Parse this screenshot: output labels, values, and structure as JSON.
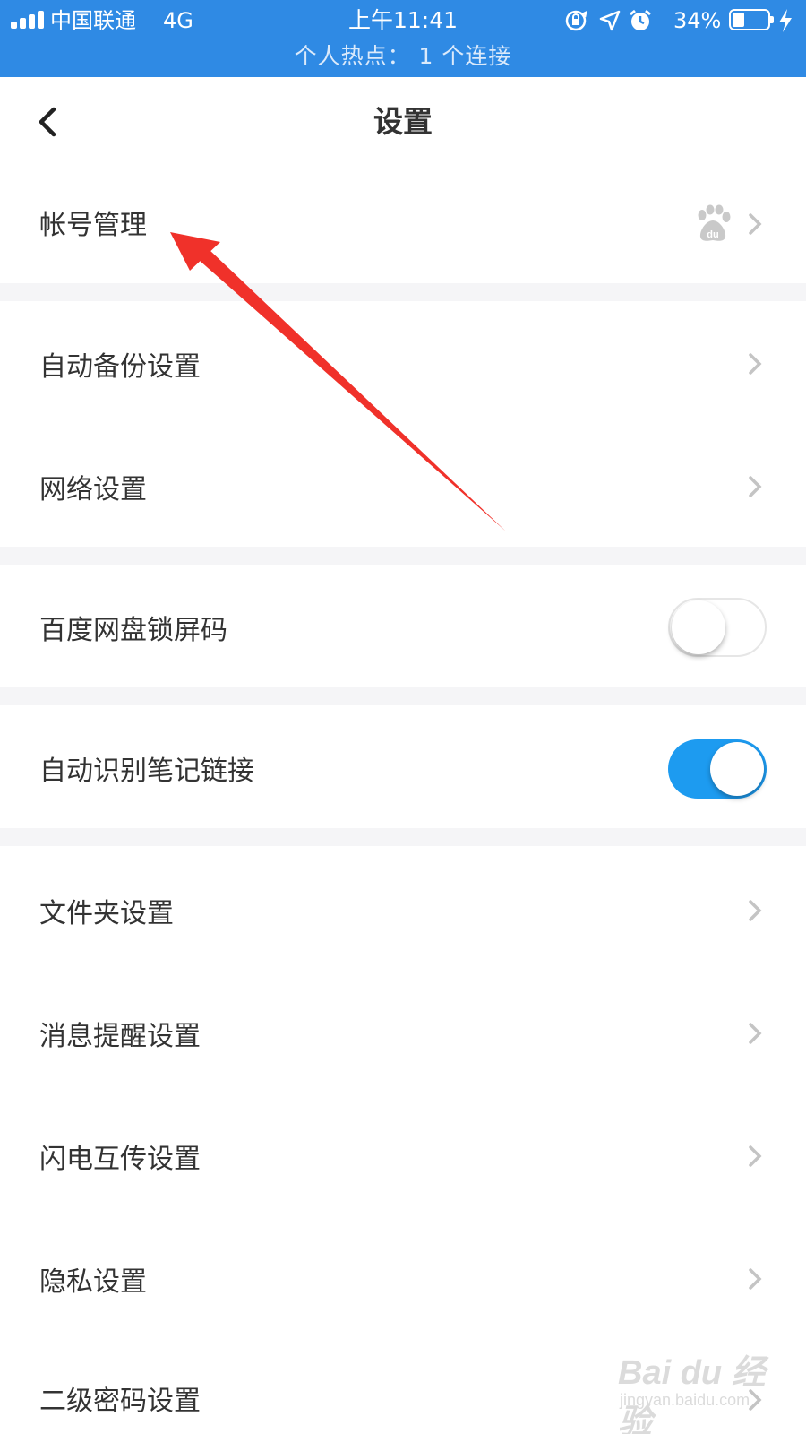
{
  "status_bar": {
    "carrier": "中国联通",
    "network": "4G",
    "time": "上午11:41",
    "battery_percent": "34%",
    "battery_level": 0.34,
    "hotspot": "个人热点： 1 个连接",
    "color": "#2f8ae4"
  },
  "nav": {
    "title": "设置",
    "back_icon": "chevron-left-icon"
  },
  "rows": {
    "account": "帐号管理",
    "auto_backup": "自动备份设置",
    "network": "网络设置",
    "lock_code": "百度网盘锁屏码",
    "note_links": "自动识别笔记链接",
    "folder": "文件夹设置",
    "notification": "消息提醒设置",
    "flash_transfer": "闪电互传设置",
    "privacy": "隐私设置",
    "second_password": "二级密码设置"
  },
  "toggles": {
    "lock_code_enabled": false,
    "note_links_enabled": true
  },
  "colors": {
    "toggle_on": "#1d9bf0",
    "annotation_arrow": "#f0312a"
  },
  "watermark": {
    "brand": "Bai du 经验",
    "url": "jingyan.baidu.com"
  }
}
